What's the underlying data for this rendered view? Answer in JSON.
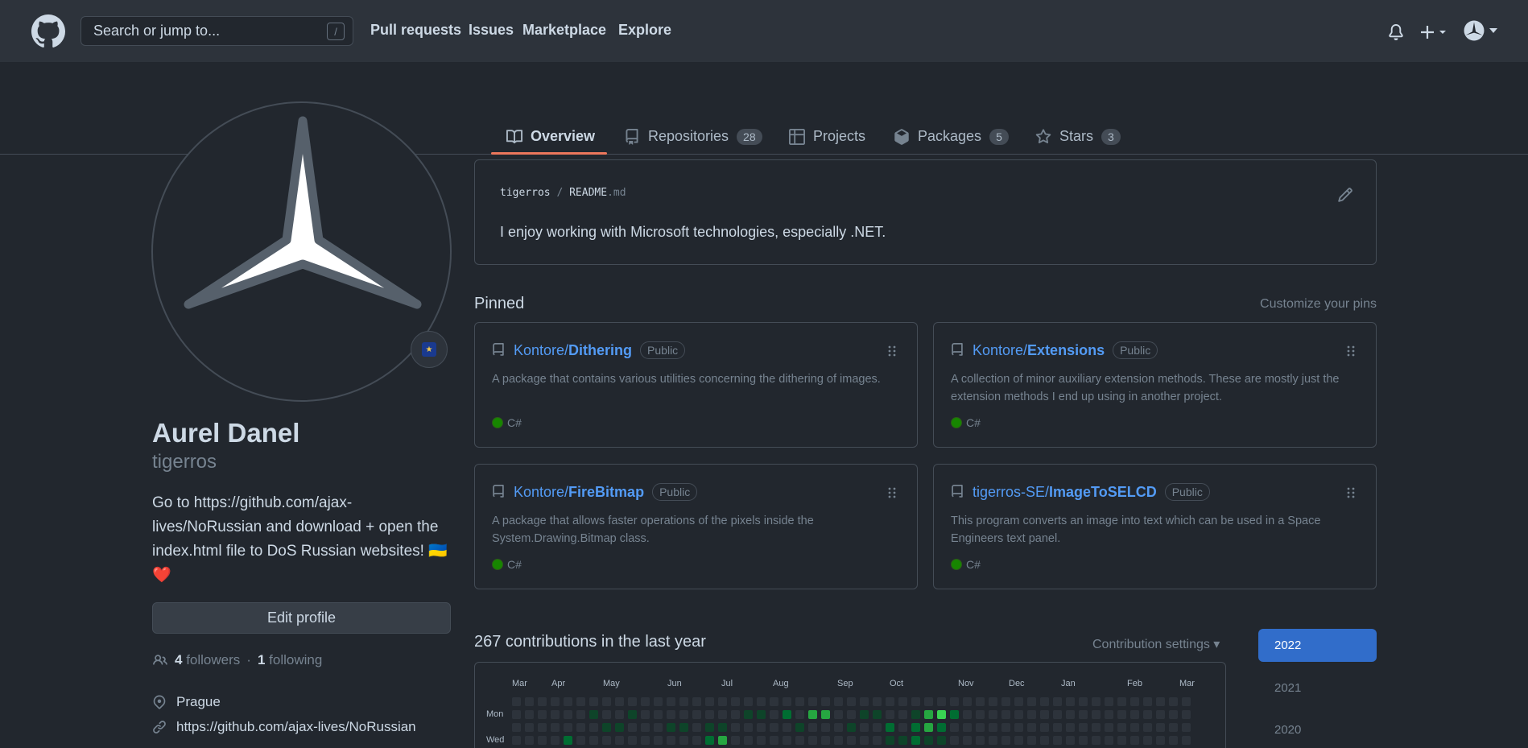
{
  "header": {
    "search_placeholder": "Search or jump to...",
    "search_shortcut": "/",
    "nav": [
      "Pull requests",
      "Issues",
      "Marketplace",
      "Explore"
    ]
  },
  "tabs": [
    {
      "label": "Overview",
      "count": null,
      "icon": "book-icon"
    },
    {
      "label": "Repositories",
      "count": "28",
      "icon": "repo-icon"
    },
    {
      "label": "Projects",
      "count": null,
      "icon": "table-icon"
    },
    {
      "label": "Packages",
      "count": "5",
      "icon": "package-icon"
    },
    {
      "label": "Stars",
      "count": "3",
      "icon": "star-icon"
    }
  ],
  "profile": {
    "name": "Aurel Danel",
    "login": "tigerros",
    "bio": "Go to https://github.com/ajax-lives/NoRussian and download + open the index.html file to DoS Russian websites! 🇺🇦❤️",
    "edit_label": "Edit profile",
    "followers_count": "4",
    "followers_label": "followers",
    "sep": "·",
    "following_count": "1",
    "following_label": "following",
    "location": "Prague",
    "website": "https://github.com/ajax-lives/NoRussian"
  },
  "readme": {
    "owner": "tigerros",
    "slash": "/",
    "file": "README",
    "ext": ".md",
    "text": "I enjoy working with Microsoft technologies, especially .NET."
  },
  "pinned": {
    "title": "Pinned",
    "customize": "Customize your pins",
    "repos": [
      {
        "owner": "Kontore/",
        "name": "Dithering",
        "visibility": "Public",
        "description": "A package that contains various utilities concerning the dithering of images.",
        "language": "C#"
      },
      {
        "owner": "Kontore/",
        "name": "Extensions",
        "visibility": "Public",
        "description": "A collection of minor auxiliary extension methods. These are mostly just the extension methods I end up using in another project.",
        "language": "C#"
      },
      {
        "owner": "Kontore/",
        "name": "FireBitmap",
        "visibility": "Public",
        "description": "A package that allows faster operations of the pixels inside the System.Drawing.Bitmap class.",
        "language": "C#"
      },
      {
        "owner": "tigerros-SE/",
        "name": "ImageToSELCD",
        "visibility": "Public",
        "description": "This program converts an image into text which can be used in a Space Engineers text panel.",
        "language": "C#"
      }
    ],
    "language_color": "#178600"
  },
  "contributions": {
    "title": "267 contributions in the last year",
    "settings": "Contribution settings ▾",
    "months": [
      "Mar",
      "Apr",
      "May",
      "Jun",
      "Jul",
      "Aug",
      "Sep",
      "Oct",
      "Nov",
      "Dec",
      "Jan",
      "Feb",
      "Mar"
    ],
    "days": [
      "Mon",
      "Wed"
    ],
    "colors": [
      "#2d333b",
      "#0e4429",
      "#006d32",
      "#26a641",
      "#39d353"
    ]
  },
  "years": [
    "2022",
    "2021",
    "2020"
  ]
}
